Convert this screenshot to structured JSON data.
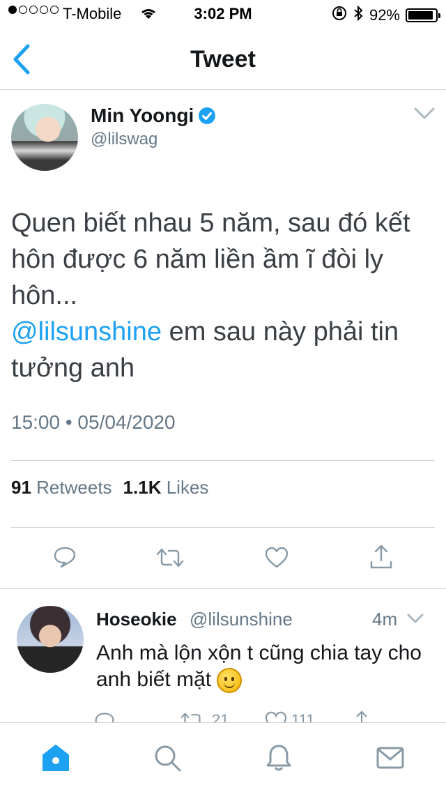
{
  "status_bar": {
    "signal_dots_filled": 1,
    "signal_dots_total": 5,
    "carrier": "T-Mobile",
    "time": "3:02 PM",
    "battery": "92%",
    "battery_level": 0.92
  },
  "nav": {
    "title": "Tweet",
    "back_icon": "chevron-left-icon"
  },
  "tweet": {
    "author_name": "Min Yoongi",
    "verified": true,
    "handle": "@lilswag",
    "text_line": "Quen biết nhau 5 năm, sau đó kết hôn được 6 năm liền ầm ĩ đòi ly hôn...",
    "mention": "@lilsunshine",
    "text_after_mention": " em sau này phải tin tưởng anh",
    "timestamp": "15:00 • 05/04/2020",
    "retweets_count": "91",
    "retweets_label": "Retweets",
    "likes_count": "1.1K",
    "likes_label": "Likes"
  },
  "reply": {
    "author_name": "Hoseokie",
    "handle": "@lilsunshine",
    "time": "4m",
    "text": "Anh mà lộn xộn t cũng chia tay cho anh biết mặt",
    "emoji": "slightly-smiling-face",
    "retweets": "21",
    "likes": "111"
  },
  "tabbar": {
    "items": [
      "home-icon",
      "search-icon",
      "notifications-icon",
      "messages-icon"
    ],
    "active": "home-icon"
  },
  "colors": {
    "accent": "#1da1f2",
    "text": "#14171a",
    "muted": "#657786",
    "icon": "#8899a6",
    "divider": "#d0d5d9"
  }
}
